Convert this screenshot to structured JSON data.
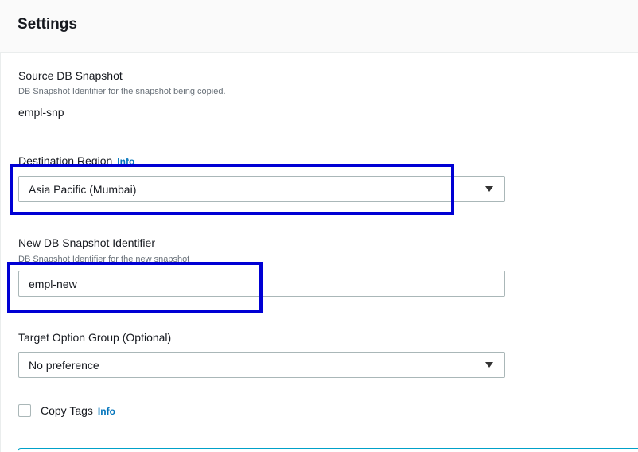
{
  "panel": {
    "title": "Settings"
  },
  "source_snapshot": {
    "label": "Source DB Snapshot",
    "description": "DB Snapshot Identifier for the snapshot being copied.",
    "value": "empl-snp"
  },
  "destination_region": {
    "label": "Destination Region",
    "info": "Info",
    "selected": "Asia Pacific (Mumbai)"
  },
  "new_snapshot": {
    "label": "New DB Snapshot Identifier",
    "description": "DB Snapshot Identifier for the new snapshot",
    "value": "empl-new"
  },
  "option_group": {
    "label": "Target Option Group (Optional)",
    "selected": "No preference"
  },
  "copy_tags": {
    "label": "Copy Tags",
    "info": "Info",
    "checked": false
  },
  "colors": {
    "highlight": "#0000d4",
    "info_link": "#0073bb",
    "accent": "#00a1c9"
  }
}
